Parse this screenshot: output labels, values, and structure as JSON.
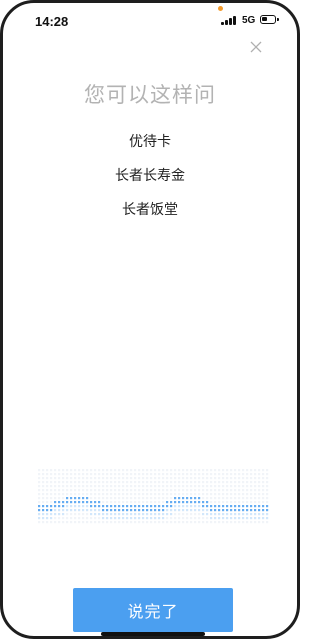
{
  "status_bar": {
    "time": "14:28",
    "network": "5G",
    "icons": [
      "signal-icon",
      "battery-icon"
    ]
  },
  "close_icon": "close-icon",
  "prompt": {
    "title": "您可以这样问",
    "suggestions": [
      "优待卡",
      "长者长寿金",
      "长者饭堂"
    ]
  },
  "voice_wave": {
    "icon": "voice-waveform-icon",
    "color": "#4b9ff0"
  },
  "done_button": {
    "label": "说完了",
    "color": "#4b9ff0"
  }
}
